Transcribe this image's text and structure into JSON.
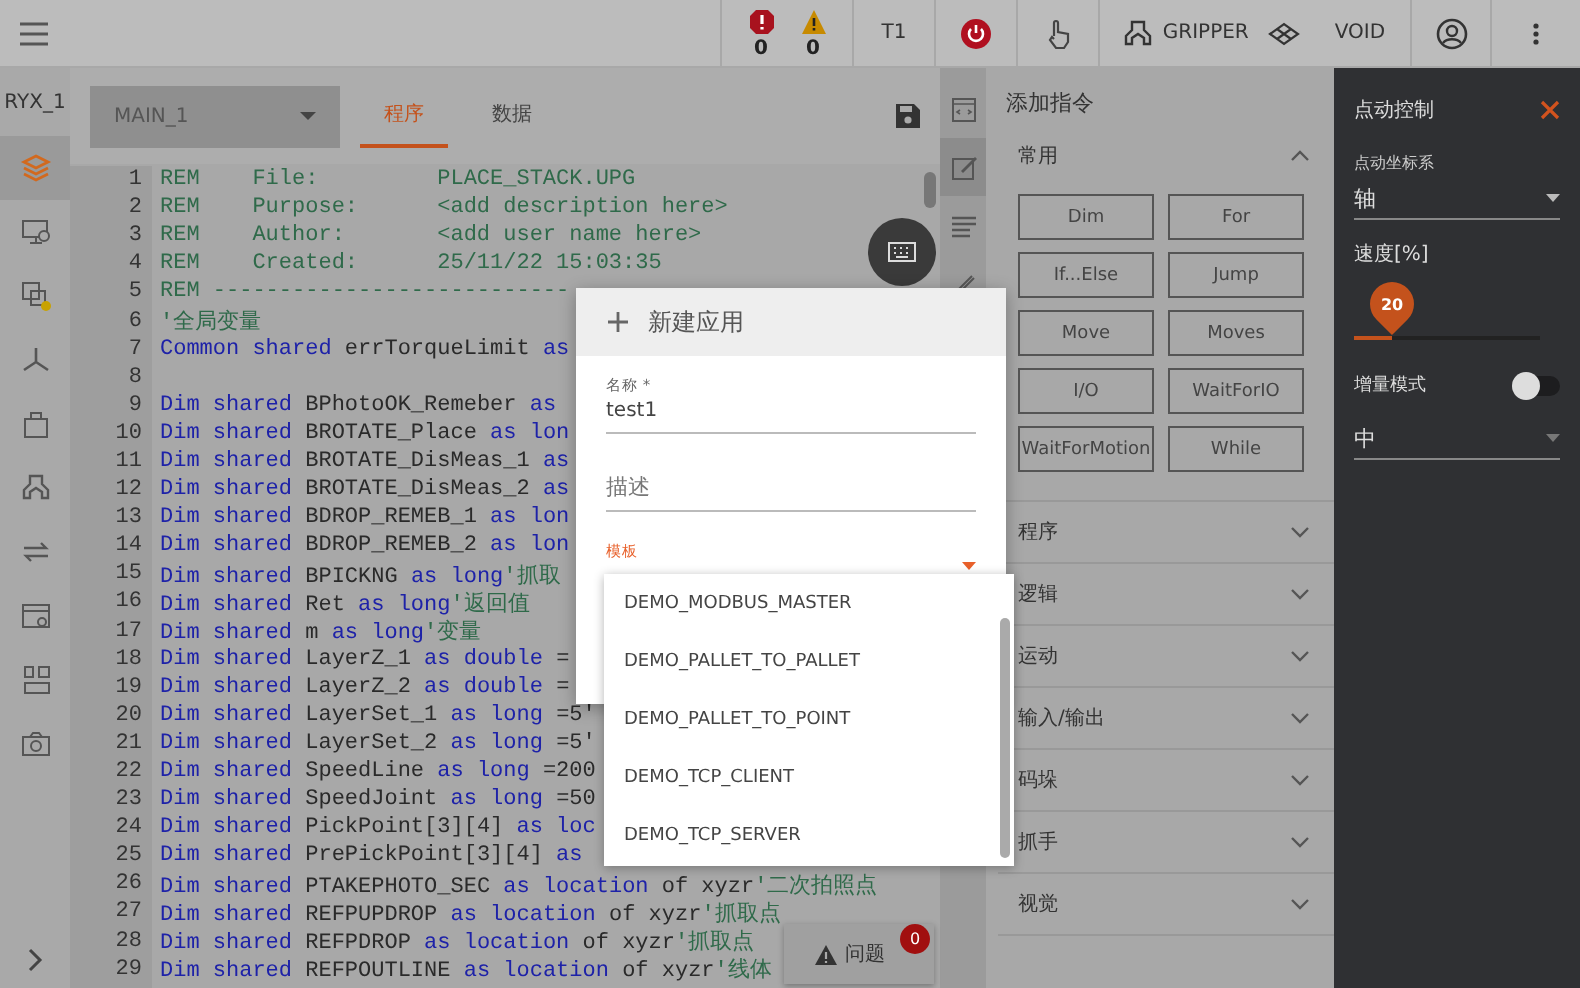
{
  "top_bar": {
    "alarms": [
      {
        "kind": "error",
        "count": "0"
      },
      {
        "kind": "warning",
        "count": "0"
      }
    ],
    "mode": "T1",
    "power": {
      "on": true
    },
    "tool": "GRIPPER",
    "workpiece": "VOID"
  },
  "robot": "RYX_1",
  "sidebar": {
    "items": [
      {
        "kind": "layers",
        "selected": true
      },
      {
        "kind": "monitor",
        "selected": false
      },
      {
        "kind": "screens",
        "selected": false
      },
      {
        "kind": "axes",
        "selected": false
      },
      {
        "kind": "bag",
        "selected": false
      },
      {
        "kind": "gripper",
        "selected": false
      },
      {
        "kind": "arrows",
        "selected": false
      },
      {
        "kind": "window",
        "selected": false
      },
      {
        "kind": "layout",
        "selected": false
      },
      {
        "kind": "camera",
        "selected": false
      }
    ]
  },
  "editor": {
    "program": "MAIN_1",
    "tabs": [
      {
        "label": "程序",
        "selected": true
      },
      {
        "label": "数据",
        "selected": false
      }
    ],
    "lines": [
      {
        "number": "1",
        "tokens": [
          {
            "kind": "comment",
            "text": "REM    File:         PLACE_STACK.UPG"
          }
        ]
      },
      {
        "number": "2",
        "tokens": [
          {
            "kind": "comment",
            "text": "REM    Purpose:      <add description here>"
          }
        ]
      },
      {
        "number": "3",
        "tokens": [
          {
            "kind": "comment",
            "text": "REM    Author:       <add user name here>"
          }
        ]
      },
      {
        "number": "4",
        "tokens": [
          {
            "kind": "comment",
            "text": "REM    Created:      25/11/22 15:03:35"
          }
        ]
      },
      {
        "number": "5",
        "tokens": [
          {
            "kind": "comment",
            "text": "REM ---------------------------"
          }
        ]
      },
      {
        "number": "6",
        "tokens": [
          {
            "kind": "comment",
            "text": "'全局变量"
          }
        ]
      },
      {
        "number": "7",
        "tokens": [
          {
            "kind": "keyword",
            "text": "Common shared "
          },
          {
            "kind": "plain",
            "text": "errTorqueLimit "
          },
          {
            "kind": "keyword",
            "text": "as"
          }
        ]
      },
      {
        "number": "8"
      },
      {
        "number": "9",
        "tokens": [
          {
            "kind": "keyword",
            "text": "Dim shared "
          },
          {
            "kind": "plain",
            "text": "BPhotoOK_Remeber "
          },
          {
            "kind": "keyword",
            "text": "as"
          }
        ]
      },
      {
        "number": "10",
        "tokens": [
          {
            "kind": "keyword",
            "text": "Dim shared "
          },
          {
            "kind": "plain",
            "text": "BROTATE_Place "
          },
          {
            "kind": "keyword",
            "text": "as lon"
          }
        ]
      },
      {
        "number": "11",
        "tokens": [
          {
            "kind": "keyword",
            "text": "Dim shared "
          },
          {
            "kind": "plain",
            "text": "BROTATE_DisMeas_1 "
          },
          {
            "kind": "keyword",
            "text": "as"
          }
        ]
      },
      {
        "number": "12",
        "tokens": [
          {
            "kind": "keyword",
            "text": "Dim shared "
          },
          {
            "kind": "plain",
            "text": "BROTATE_DisMeas_2 "
          },
          {
            "kind": "keyword",
            "text": "as"
          }
        ]
      },
      {
        "number": "13",
        "tokens": [
          {
            "kind": "keyword",
            "text": "Dim shared "
          },
          {
            "kind": "plain",
            "text": "BDROP_REMEB_1 "
          },
          {
            "kind": "keyword",
            "text": "as lon"
          }
        ]
      },
      {
        "number": "14",
        "tokens": [
          {
            "kind": "keyword",
            "text": "Dim shared "
          },
          {
            "kind": "plain",
            "text": "BDROP_REMEB_2 "
          },
          {
            "kind": "keyword",
            "text": "as lon"
          }
        ]
      },
      {
        "number": "15",
        "tokens": [
          {
            "kind": "keyword",
            "text": "Dim shared "
          },
          {
            "kind": "plain",
            "text": "BPICKNG "
          },
          {
            "kind": "keyword",
            "text": "as long"
          },
          {
            "kind": "comment",
            "text": "'抓取"
          }
        ]
      },
      {
        "number": "16",
        "tokens": [
          {
            "kind": "keyword",
            "text": "Dim shared "
          },
          {
            "kind": "plain",
            "text": "Ret "
          },
          {
            "kind": "keyword",
            "text": "as long"
          },
          {
            "kind": "comment",
            "text": "'返回值"
          }
        ]
      },
      {
        "number": "17",
        "tokens": [
          {
            "kind": "keyword",
            "text": "Dim shared "
          },
          {
            "kind": "plain",
            "text": "m "
          },
          {
            "kind": "keyword",
            "text": "as long"
          },
          {
            "kind": "comment",
            "text": "'变量"
          }
        ]
      },
      {
        "number": "18",
        "tokens": [
          {
            "kind": "keyword",
            "text": "Dim shared "
          },
          {
            "kind": "plain",
            "text": "LayerZ_1 "
          },
          {
            "kind": "keyword",
            "text": "as double "
          },
          {
            "kind": "plain",
            "text": "="
          }
        ]
      },
      {
        "number": "19",
        "tokens": [
          {
            "kind": "keyword",
            "text": "Dim shared "
          },
          {
            "kind": "plain",
            "text": "LayerZ_2 "
          },
          {
            "kind": "keyword",
            "text": "as double "
          },
          {
            "kind": "plain",
            "text": "="
          }
        ]
      },
      {
        "number": "20",
        "tokens": [
          {
            "kind": "keyword",
            "text": "Dim shared "
          },
          {
            "kind": "plain",
            "text": "LayerSet_1 "
          },
          {
            "kind": "keyword",
            "text": "as long "
          },
          {
            "kind": "plain",
            "text": "=5'"
          }
        ]
      },
      {
        "number": "21",
        "tokens": [
          {
            "kind": "keyword",
            "text": "Dim shared "
          },
          {
            "kind": "plain",
            "text": "LayerSet_2 "
          },
          {
            "kind": "keyword",
            "text": "as long "
          },
          {
            "kind": "plain",
            "text": "=5'"
          }
        ]
      },
      {
        "number": "22",
        "tokens": [
          {
            "kind": "keyword",
            "text": "Dim shared "
          },
          {
            "kind": "plain",
            "text": "SpeedLine "
          },
          {
            "kind": "keyword",
            "text": "as long "
          },
          {
            "kind": "plain",
            "text": "=200"
          }
        ]
      },
      {
        "number": "23",
        "tokens": [
          {
            "kind": "keyword",
            "text": "Dim shared "
          },
          {
            "kind": "plain",
            "text": "SpeedJoint "
          },
          {
            "kind": "keyword",
            "text": "as long "
          },
          {
            "kind": "plain",
            "text": "=50"
          }
        ]
      },
      {
        "number": "24",
        "tokens": [
          {
            "kind": "keyword",
            "text": "Dim shared "
          },
          {
            "kind": "plain",
            "text": "PickPoint[3][4] "
          },
          {
            "kind": "keyword",
            "text": "as loc"
          }
        ]
      },
      {
        "number": "25",
        "tokens": [
          {
            "kind": "keyword",
            "text": "Dim shared "
          },
          {
            "kind": "plain",
            "text": "PrePickPoint[3][4] "
          },
          {
            "kind": "keyword",
            "text": "as"
          }
        ]
      },
      {
        "number": "26",
        "tokens": [
          {
            "kind": "keyword",
            "text": "Dim shared "
          },
          {
            "kind": "plain",
            "text": "PTAKEPHOTO_SEC "
          },
          {
            "kind": "keyword",
            "text": "as location "
          },
          {
            "kind": "plain",
            "text": "of xyzr"
          },
          {
            "kind": "comment",
            "text": "'二次拍照点"
          }
        ]
      },
      {
        "number": "27",
        "tokens": [
          {
            "kind": "keyword",
            "text": "Dim shared "
          },
          {
            "kind": "plain",
            "text": "REFPUPDROP "
          },
          {
            "kind": "keyword",
            "text": "as location "
          },
          {
            "kind": "plain",
            "text": "of xyzr"
          },
          {
            "kind": "comment",
            "text": "'抓取点"
          }
        ]
      },
      {
        "number": "28",
        "tokens": [
          {
            "kind": "keyword",
            "text": "Dim shared "
          },
          {
            "kind": "plain",
            "text": "REFPDROP "
          },
          {
            "kind": "keyword",
            "text": "as location "
          },
          {
            "kind": "plain",
            "text": "of xyzr"
          },
          {
            "kind": "comment",
            "text": "'抓取点"
          }
        ]
      },
      {
        "number": "29",
        "tokens": [
          {
            "kind": "keyword",
            "text": "Dim shared "
          },
          {
            "kind": "plain",
            "text": "REFPOUTLINE "
          },
          {
            "kind": "keyword",
            "text": "as location "
          },
          {
            "kind": "plain",
            "text": "of xyzr"
          },
          {
            "kind": "comment",
            "text": "'线体"
          }
        ]
      }
    ]
  },
  "tool_strip": [
    {
      "kind": "code",
      "selected": false
    },
    {
      "kind": "edit",
      "selected": true
    },
    {
      "kind": "list",
      "selected": false
    },
    {
      "kind": "pen",
      "selected": false
    }
  ],
  "instructions": {
    "title": "添加指令",
    "sections": [
      {
        "label": "常用",
        "expanded": true,
        "buttons": [
          "Dim",
          "For",
          "If...Else",
          "Jump",
          "Move",
          "Moves",
          "I/O",
          "WaitForIO",
          "WaitForMotion",
          "While"
        ]
      },
      {
        "label": "程序",
        "expanded": false
      },
      {
        "label": "逻辑",
        "expanded": false
      },
      {
        "label": "运动",
        "expanded": false
      },
      {
        "label": "输入/输出",
        "expanded": false
      },
      {
        "label": "码垛",
        "expanded": false
      },
      {
        "label": "抓手",
        "expanded": false
      },
      {
        "label": "视觉",
        "expanded": false
      }
    ]
  },
  "jog_panel": {
    "title": "点动控制",
    "frame": {
      "label": "点动坐标系",
      "value": "轴"
    },
    "speed": {
      "label": "速度[%]",
      "reading": "20",
      "level": 0.2
    },
    "increment": {
      "label": "增量模式",
      "on": false
    },
    "step": {
      "value": "中"
    }
  },
  "dialog": {
    "title": "新建应用",
    "name": {
      "label": "名称 *",
      "value": "test1"
    },
    "description": {
      "placeholder": "描述"
    },
    "template": {
      "label": "模板"
    },
    "options": [
      {
        "label": "DEMO_MODBUS_MASTER",
        "selected": false
      },
      {
        "label": "DEMO_PALLET_TO_PALLET",
        "selected": false
      },
      {
        "label": "DEMO_PALLET_TO_POINT",
        "selected": false
      },
      {
        "label": "DEMO_TCP_CLIENT",
        "selected": false
      },
      {
        "label": "DEMO_TCP_SERVER",
        "selected": false
      }
    ]
  },
  "problems": {
    "label": "问题",
    "count": "0"
  }
}
